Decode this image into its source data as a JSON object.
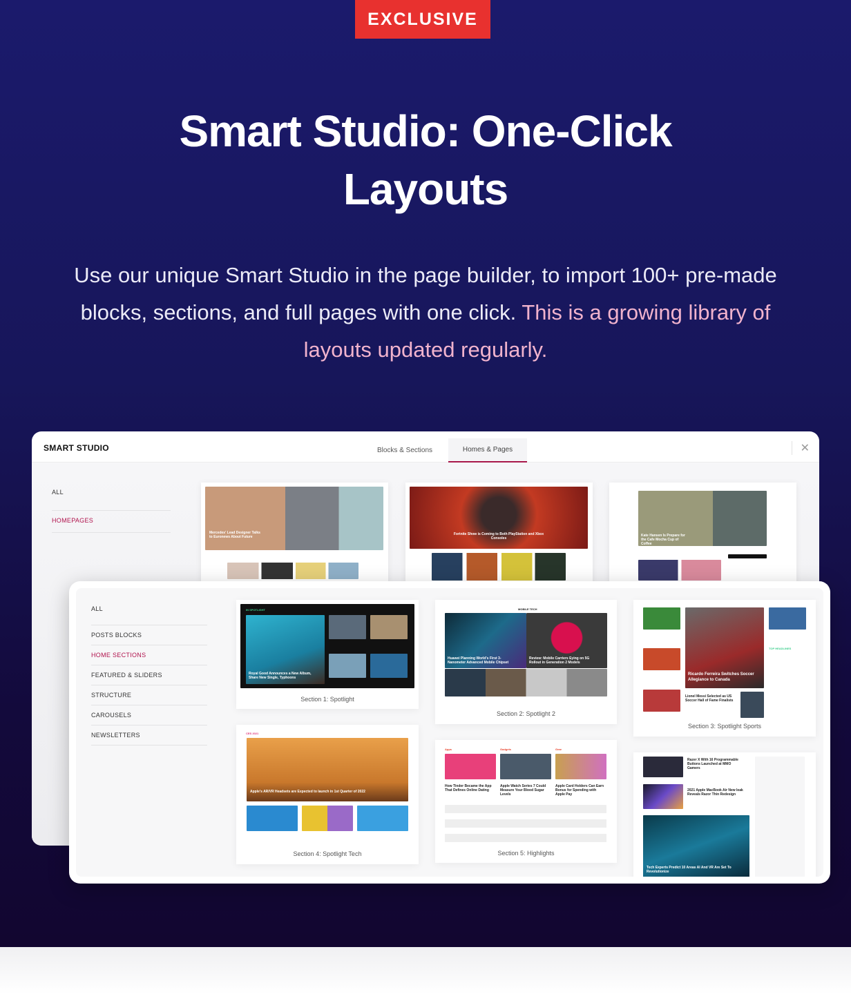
{
  "hero": {
    "badge": "EXCLUSIVE",
    "title": "Smart Studio: One-Click Layouts",
    "subtitle_main": "Use our unique Smart Studio in the page builder, to import 100+ pre-made blocks, sections, and full pages with one click.",
    "subtitle_accent": "This is a growing library of layouts updated regularly.",
    "colors": {
      "badge": "#e8312f",
      "accent": "#f1b3cd",
      "background": "#1b1a6c"
    }
  },
  "back_window": {
    "brand": "SMART STUDIO",
    "tabs": [
      {
        "label": "Blocks & Sections",
        "active": false
      },
      {
        "label": "Homes & Pages",
        "active": true
      }
    ],
    "close_icon": "close-icon",
    "sidebar": [
      {
        "label": "ALL",
        "active": false
      },
      {
        "label": "HOMEPAGES",
        "active": true
      }
    ],
    "thumbnails": [
      {
        "headline": "Mercedes' Lead Designer Talks to Euronews About Future"
      },
      {
        "headline": "Fortnite Show is Coming to Both PlayStation and Xbox Consoles"
      },
      {
        "headline": "Kate Hansen Is Prepare for the Cafe Mocha Cup of Coffee"
      }
    ]
  },
  "front_window": {
    "sidebar": [
      {
        "label": "ALL",
        "active": false
      },
      {
        "label": "POSTS BLOCKS",
        "active": false
      },
      {
        "label": "HOME SECTIONS",
        "active": true
      },
      {
        "label": "FEATURED & SLIDERS",
        "active": false
      },
      {
        "label": "STRUCTURE",
        "active": false
      },
      {
        "label": "CAROUSELS",
        "active": false
      },
      {
        "label": "NEWSLETTERS",
        "active": false
      }
    ],
    "cards": [
      {
        "caption": "Section 1: Spotlight",
        "kicker": "IN SPOTLIGHT",
        "headline": "Royal Good Announces a New Album, Share New Single, Typhoons"
      },
      {
        "caption": "Section 2: Spotlight 2",
        "kicker": "MOBILE TECH",
        "headline": "Huawei Planning World's First 3-Nanometer Advanced Mobile Chipset",
        "headline2": "Review: Mobile Carriers Eying on 5G Rollout in Generation 2 Models"
      },
      {
        "caption": "Section 3: Spotlight Sports",
        "kicker": "TOP HEADLINES",
        "headline": "Ricardo Ferreira Switches Soccer Allegiance to Canada",
        "headline2": "Lionel Messi Selected as US Soccer Hall of Fame Finalists"
      },
      {
        "caption": "Section 4: Spotlight Tech",
        "kicker": "CES 2021",
        "headline": "Apple's AR/VR Headsets are Expected to launch in 1st Quarter of 2022"
      },
      {
        "caption": "Section 5: Highlights",
        "columns": [
          "Apps",
          "Gadgets",
          "Gear"
        ],
        "headlines": [
          "How Tinder Became the App That Defines Online Dating",
          "Apple Watch Series 7 Could Measure Your Blood Sugar Levels",
          "Apple Card Holders Can Earn Bonus for Spending with Apple Pay"
        ]
      },
      {
        "caption": "",
        "headlines": [
          "Razer X With 16 Programmable Buttons Launched at MMO Gamers",
          "2021 Apple MacBook Air New leak Reveals Razor Thin Redesign",
          "Tech Experts Predict 10 Areas AI And VR Are Set To Revolutionize"
        ]
      }
    ]
  }
}
